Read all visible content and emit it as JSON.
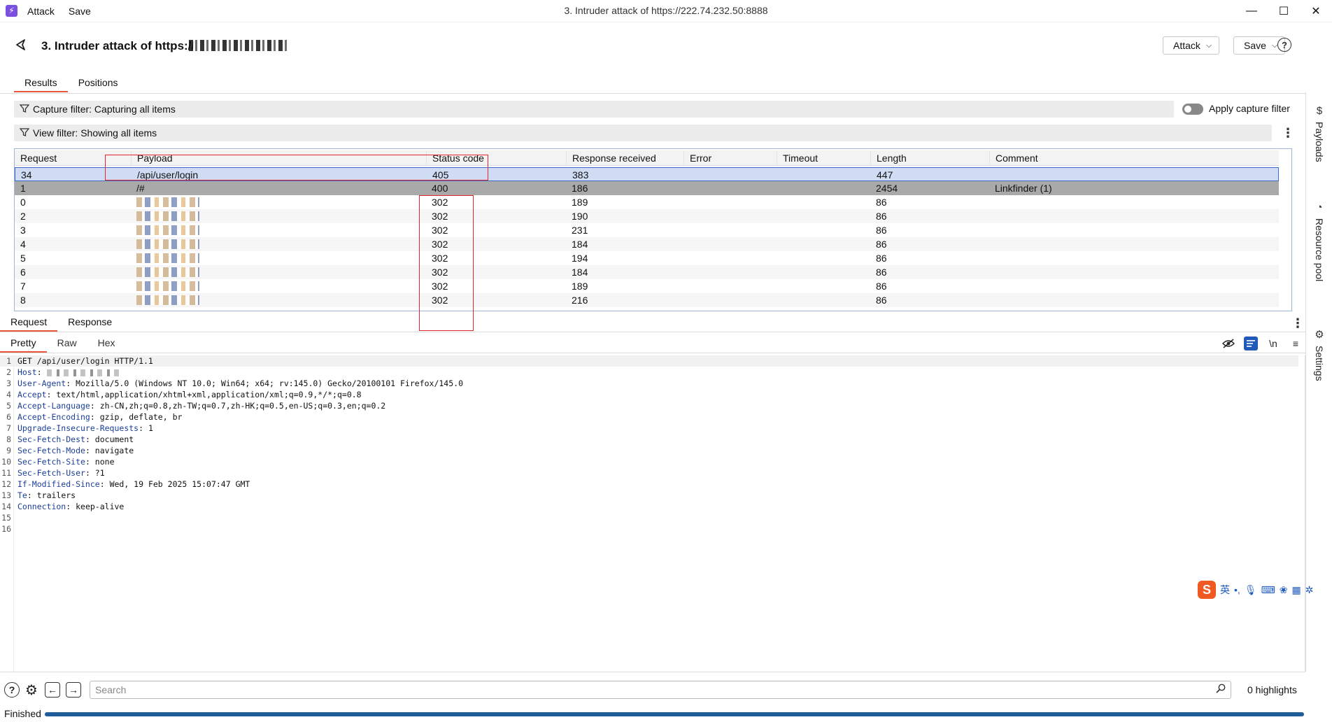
{
  "titlebar": {
    "menu_attack": "Attack",
    "menu_save": "Save",
    "window_title": "3. Intruder attack of https://222.74.232.50:8888"
  },
  "header": {
    "title": "3. Intruder attack of https://",
    "attack_btn": "Attack",
    "save_btn": "Save"
  },
  "tabs": [
    "Results",
    "Positions"
  ],
  "filters": {
    "capture": "Capture filter: Capturing all items",
    "view": "View filter: Showing all items",
    "apply_capture": "Apply capture filter",
    "apply_capture_on": false
  },
  "table": {
    "columns": [
      "Request",
      "Payload",
      "Status code",
      "Response received",
      "Error",
      "Timeout",
      "Length",
      "Comment"
    ],
    "rows": [
      {
        "request": "34",
        "payload": "/api/user/login",
        "status": "405",
        "received": "383",
        "error": "",
        "timeout": "",
        "length": "447",
        "comment": ""
      },
      {
        "request": "1",
        "payload": "/#",
        "status": "400",
        "received": "186",
        "error": "",
        "timeout": "",
        "length": "2454",
        "comment": "Linkfinder (1)"
      },
      {
        "request": "0",
        "payload": "",
        "status": "302",
        "received": "189",
        "error": "",
        "timeout": "",
        "length": "86",
        "comment": ""
      },
      {
        "request": "2",
        "payload": "",
        "status": "302",
        "received": "190",
        "error": "",
        "timeout": "",
        "length": "86",
        "comment": ""
      },
      {
        "request": "3",
        "payload": "",
        "status": "302",
        "received": "231",
        "error": "",
        "timeout": "",
        "length": "86",
        "comment": ""
      },
      {
        "request": "4",
        "payload": "",
        "status": "302",
        "received": "184",
        "error": "",
        "timeout": "",
        "length": "86",
        "comment": ""
      },
      {
        "request": "5",
        "payload": "",
        "status": "302",
        "received": "194",
        "error": "",
        "timeout": "",
        "length": "86",
        "comment": ""
      },
      {
        "request": "6",
        "payload": "",
        "status": "302",
        "received": "184",
        "error": "",
        "timeout": "",
        "length": "86",
        "comment": ""
      },
      {
        "request": "7",
        "payload": "",
        "status": "302",
        "received": "189",
        "error": "",
        "timeout": "",
        "length": "86",
        "comment": ""
      },
      {
        "request": "8",
        "payload": "",
        "status": "302",
        "received": "216",
        "error": "",
        "timeout": "",
        "length": "86",
        "comment": ""
      }
    ]
  },
  "sidebar": [
    "Payloads",
    "Resource pool",
    "Settings"
  ],
  "rr_tabs": [
    "Request",
    "Response"
  ],
  "view_tabs": [
    "Pretty",
    "Raw",
    "Hex"
  ],
  "view_tools": {
    "newline": "\\n"
  },
  "request_lines": [
    {
      "n": "1",
      "name": "",
      "value": "GET /api/user/login HTTP/1.1"
    },
    {
      "n": "2",
      "name": "Host",
      "value": ""
    },
    {
      "n": "3",
      "name": "User-Agent",
      "value": "Mozilla/5.0 (Windows NT 10.0; Win64; x64; rv:145.0) Gecko/20100101 Firefox/145.0"
    },
    {
      "n": "4",
      "name": "Accept",
      "value": "text/html,application/xhtml+xml,application/xml;q=0.9,*/*;q=0.8"
    },
    {
      "n": "5",
      "name": "Accept-Language",
      "value": "zh-CN,zh;q=0.8,zh-TW;q=0.7,zh-HK;q=0.5,en-US;q=0.3,en;q=0.2"
    },
    {
      "n": "6",
      "name": "Accept-Encoding",
      "value": "gzip, deflate, br"
    },
    {
      "n": "7",
      "name": "Upgrade-Insecure-Requests",
      "value": "1"
    },
    {
      "n": "8",
      "name": "Sec-Fetch-Dest",
      "value": "document"
    },
    {
      "n": "9",
      "name": "Sec-Fetch-Mode",
      "value": "navigate"
    },
    {
      "n": "10",
      "name": "Sec-Fetch-Site",
      "value": "none"
    },
    {
      "n": "11",
      "name": "Sec-Fetch-User",
      "value": "?1"
    },
    {
      "n": "12",
      "name": "If-Modified-Since",
      "value": "Wed, 19 Feb 2025 15:07:47 GMT"
    },
    {
      "n": "13",
      "name": "Te",
      "value": "trailers"
    },
    {
      "n": "14",
      "name": "Connection",
      "value": "keep-alive"
    },
    {
      "n": "15",
      "name": "",
      "value": ""
    },
    {
      "n": "16",
      "name": "",
      "value": ""
    }
  ],
  "ime": {
    "lang": "英"
  },
  "bottom": {
    "search_placeholder": "Search",
    "highlights": "0 highlights"
  },
  "status": {
    "text": "Finished",
    "progress": 1.0
  },
  "colors": {
    "accent": "#e8573a",
    "selection": "#cfdcf3",
    "progress": "#1f5c9a",
    "annotation": "#e0252b"
  }
}
